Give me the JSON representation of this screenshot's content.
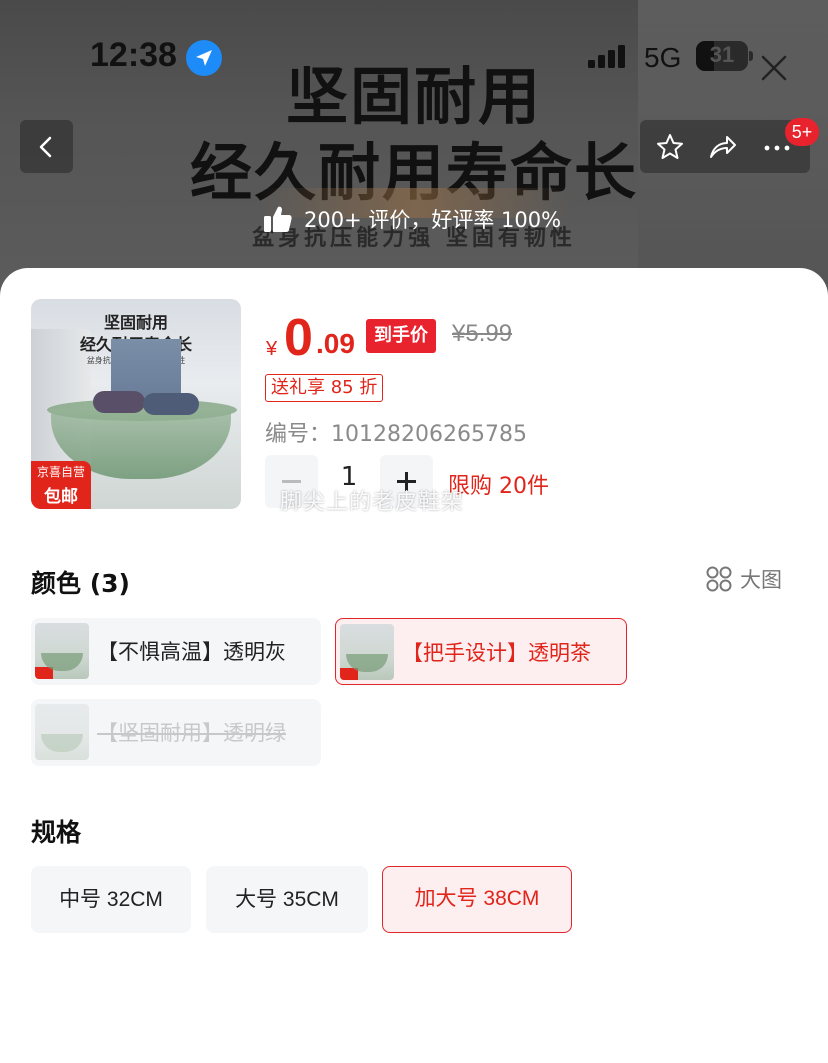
{
  "status_bar": {
    "time": "12:38",
    "network": "5G",
    "battery": "31"
  },
  "hero": {
    "title_line1": "坚固耐用",
    "title_line2": "经久耐用寿命长",
    "subtitle": "盆身抗压能力强 坚固有韧性",
    "review_text": "200+ 评价，好评率 100%"
  },
  "nav": {
    "cart_badge": "5+"
  },
  "product": {
    "image": {
      "title1": "坚固耐用",
      "title2": "经久耐用寿命长",
      "subtitle": "盆身抗压能力强 坚固有韧性",
      "tag_top": "京喜自营",
      "tag_bottom": "包邮"
    },
    "price": {
      "currency": "¥",
      "integer": "0",
      "decimal": ".09",
      "label": "到手价",
      "original": "¥5.99"
    },
    "promo": "送礼享 85 折",
    "sku": "编号：10128206265785",
    "quantity": "1",
    "limit": "限购 20件",
    "watermark": "脚尖上的老皮鞋架"
  },
  "color_section": {
    "title": "颜色 (3)",
    "big_view": "大图",
    "options": [
      {
        "label": "【不惧高温】透明灰",
        "state": "normal"
      },
      {
        "label": "【把手设计】透明茶",
        "state": "selected"
      },
      {
        "label": "【坚固耐用】透明绿",
        "state": "disabled"
      }
    ]
  },
  "spec_section": {
    "title": "规格",
    "options": [
      {
        "label": "中号 32CM",
        "state": "normal"
      },
      {
        "label": "大号 35CM",
        "state": "normal"
      },
      {
        "label": "加大号 38CM",
        "state": "selected"
      }
    ]
  },
  "colors": {
    "accent": "#e1251b",
    "selected_bg": "#fdeef0",
    "chip_bg": "#f5f6f8"
  }
}
